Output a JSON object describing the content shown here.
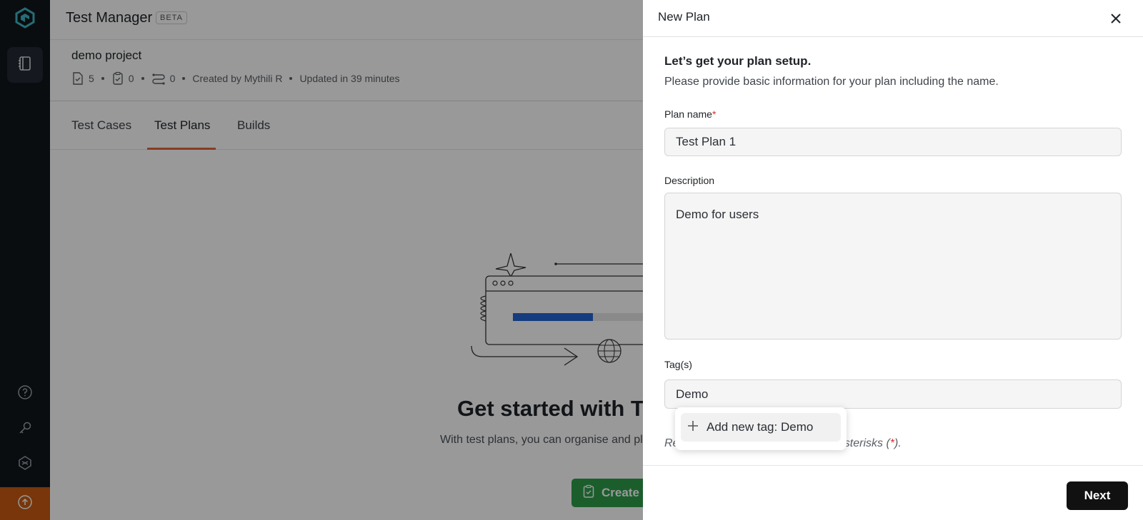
{
  "app": {
    "title": "Test Manager",
    "badge": "BETA"
  },
  "project": {
    "name": "demo project",
    "test_cases_count": "5",
    "test_plans_count": "0",
    "builds_count": "0",
    "created_by": "Created by Mythili R",
    "updated": "Updated in 39 minutes"
  },
  "tabs": [
    {
      "label": "Test Cases",
      "active": false
    },
    {
      "label": "Test Plans",
      "active": true
    },
    {
      "label": "Builds",
      "active": false
    }
  ],
  "empty_state": {
    "title": "Get started with Tes",
    "description": "With test plans, you can organise and plan yo",
    "create_button": "Create Test Plan"
  },
  "sidebar": {
    "icons": [
      "logo-icon",
      "test-manager-icon",
      "help-icon",
      "key-icon",
      "integrations-icon",
      "upgrade-icon"
    ]
  },
  "drawer": {
    "title": "New Plan",
    "setup_title": "Let’s get your plan setup.",
    "setup_desc": "Please provide basic information for your plan including the name.",
    "plan_name_label": "Plan name",
    "plan_name_value": "Test Plan 1",
    "description_label": "Description",
    "description_value": "Demo for users",
    "tags_label": "Tag(s)",
    "tags_value": "Demo",
    "tag_suggestion": "Add new tag: Demo",
    "helper_start": "Re",
    "helper_end": " asterisks (",
    "helper_star": "*",
    "helper_close": ").",
    "next_button": "Next"
  },
  "colors": {
    "sidebar_bg": "#12161c",
    "accent_tab": "#e0663b",
    "create_button": "#2e9d4a",
    "next_button": "#111111",
    "upgrade": "#c85b12"
  }
}
